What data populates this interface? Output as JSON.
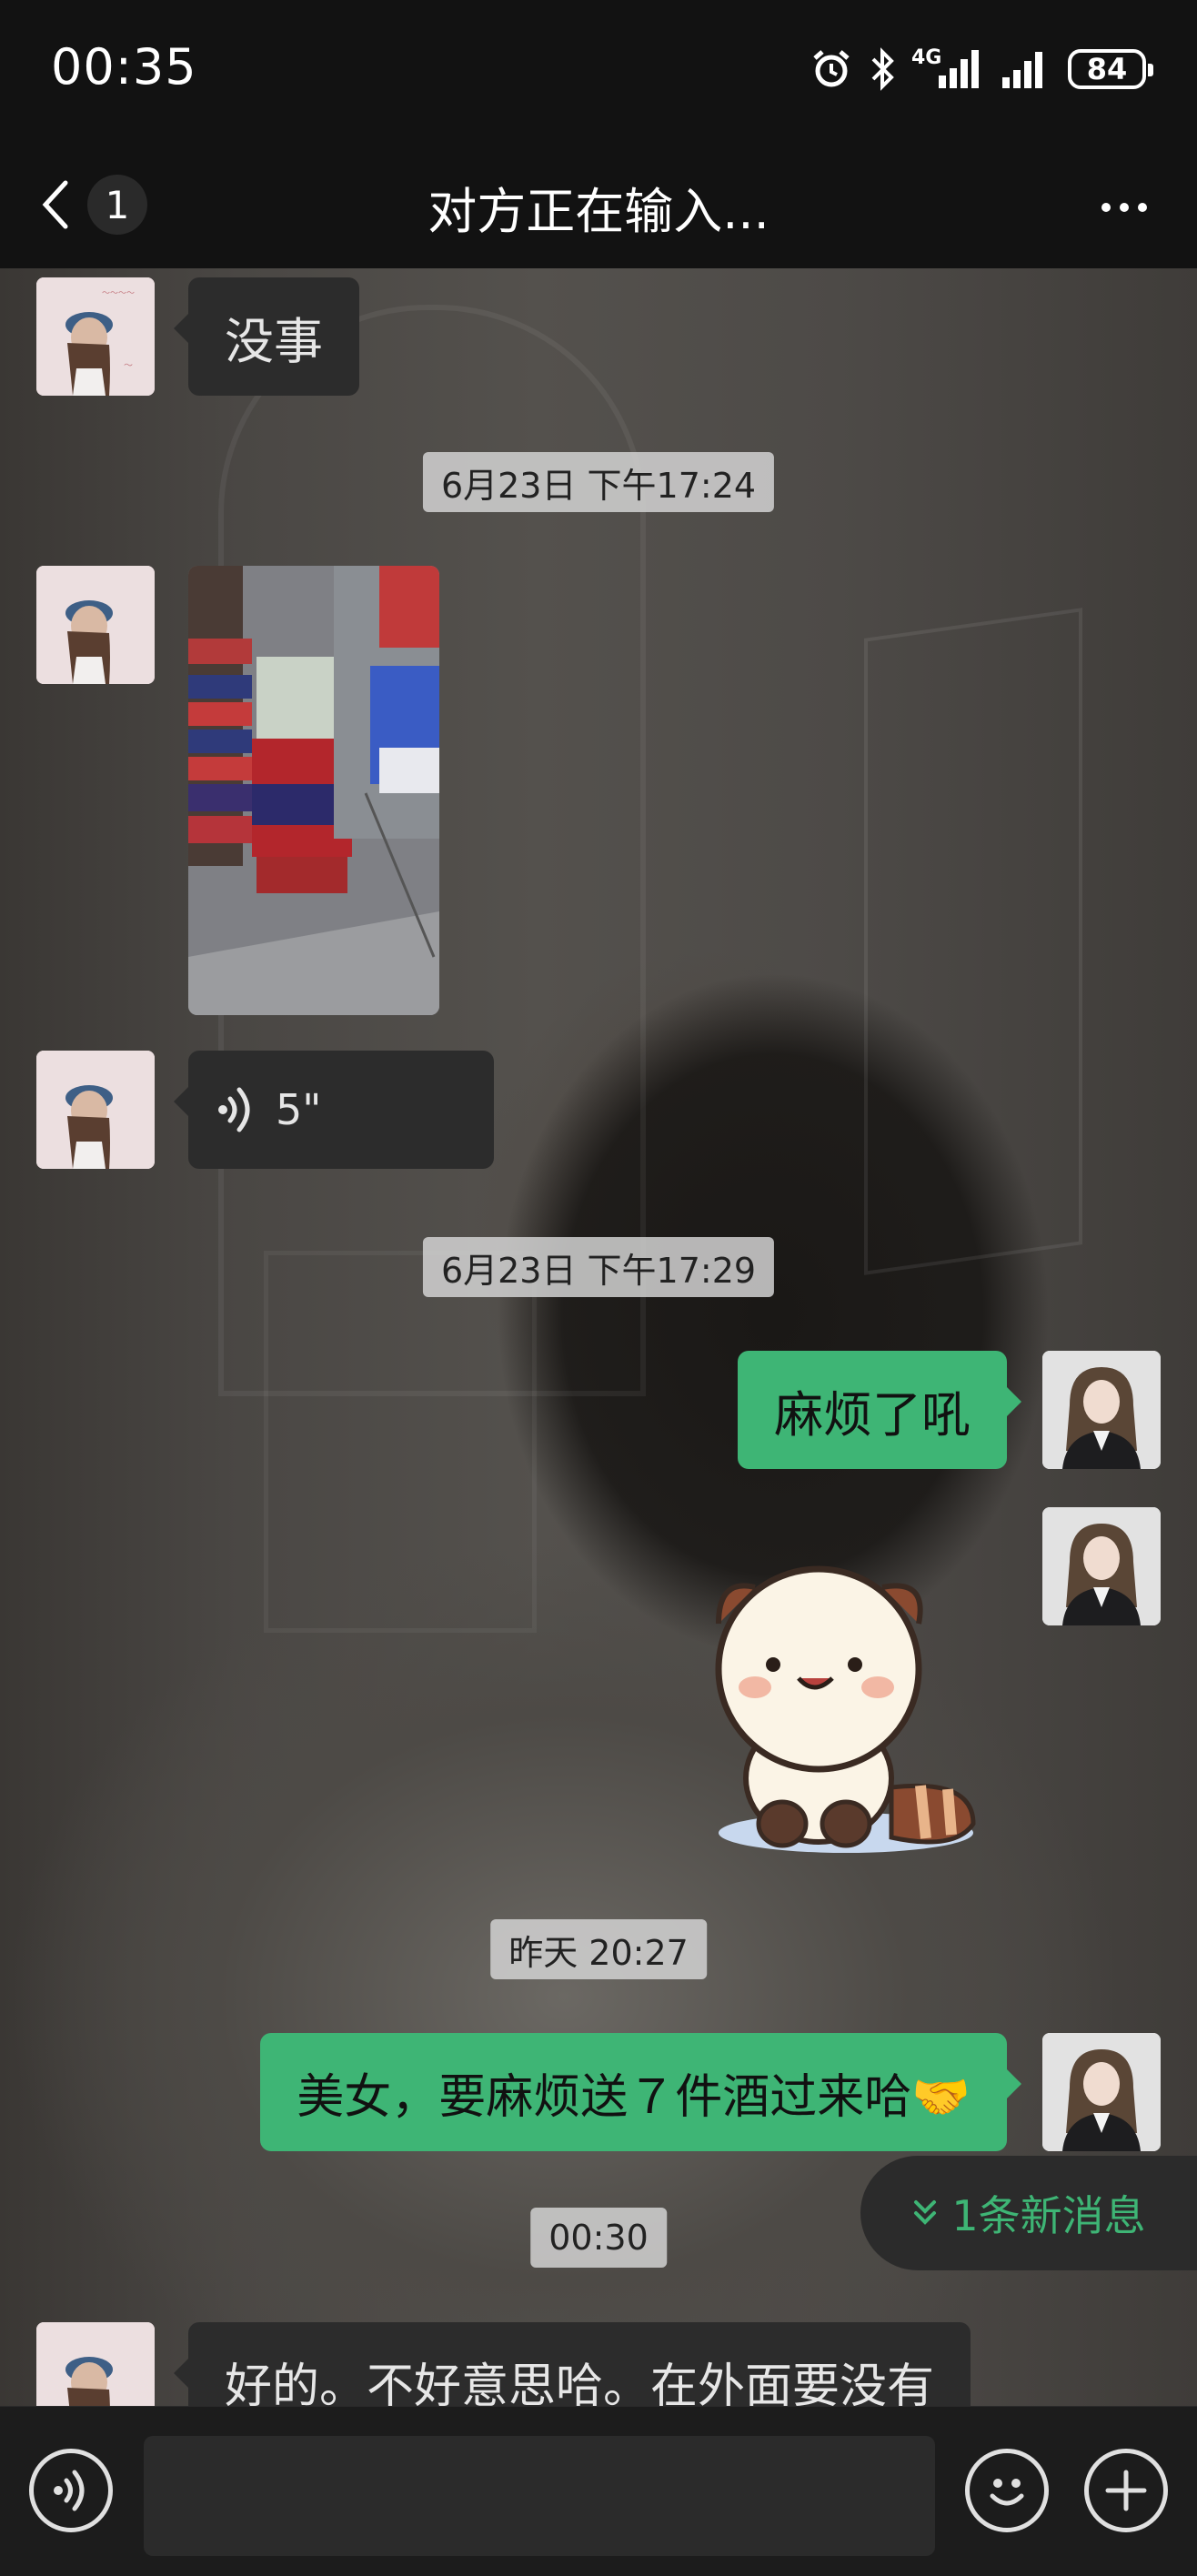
{
  "status_bar": {
    "time": "00:35",
    "network_label": "4G",
    "battery": "84"
  },
  "nav": {
    "unread_count": "1",
    "title": "对方正在输入..."
  },
  "messages": {
    "m1_text": "没事",
    "ts1": "6月23日 下午17:24",
    "voice_duration": "5\"",
    "ts2": "6月23日 下午17:29",
    "m_out1_text": "麻烦了吼",
    "ts3": "昨天 20:27",
    "m_out2_text": "美女，要麻烦送７件酒过来哈🤝",
    "ts4": "00:30",
    "m_last_text": "好的。不好意思哈。在外面要没有"
  },
  "new_messages_pill": "1条新消息",
  "input": {
    "value": "",
    "placeholder": ""
  },
  "colors": {
    "accent_green": "#3eb575",
    "background": "#121212",
    "incoming_bubble": "#2c2c2c"
  },
  "icons": [
    "back-chevron-icon",
    "more-dots-icon",
    "alarm-icon",
    "bluetooth-icon",
    "signal-icon",
    "voice-wave-icon",
    "emoji-icon",
    "plus-icon",
    "double-chevron-down-icon"
  ]
}
